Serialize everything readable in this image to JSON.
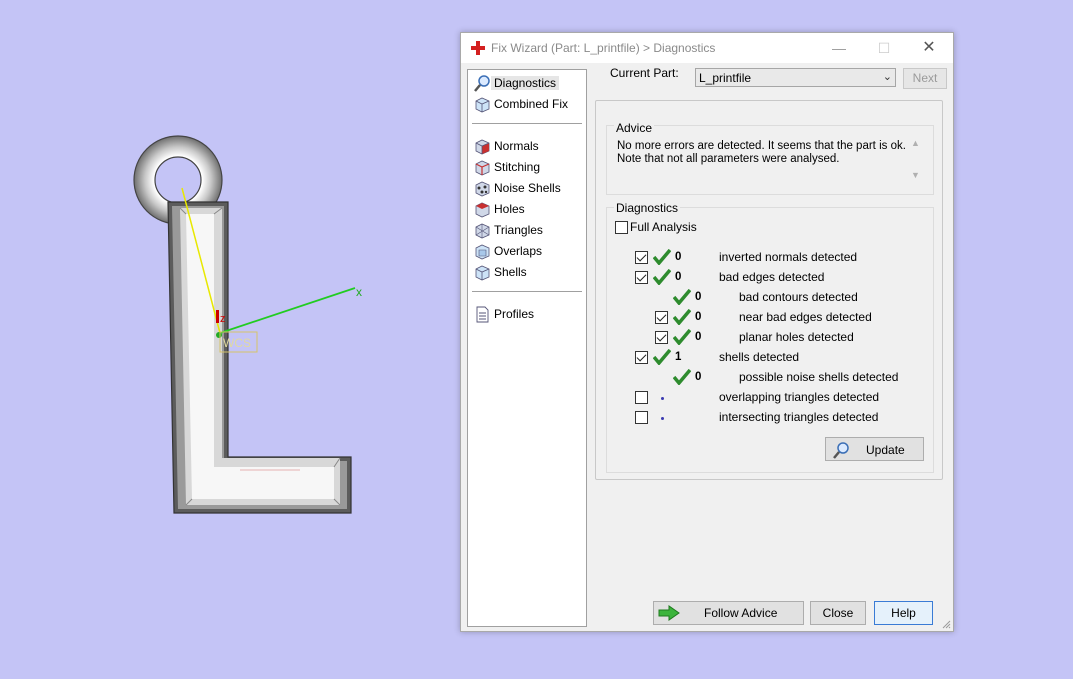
{
  "viewport": {
    "axis_x_label": "x",
    "axis_z_label": "z",
    "wcs_label": "WCS"
  },
  "window": {
    "title": "Fix Wizard (Part: L_printfile) > Diagnostics"
  },
  "nav": {
    "items_top": [
      {
        "label": "Diagnostics",
        "icon": "magnifier-icon",
        "selected": true
      },
      {
        "label": "Combined Fix",
        "icon": "cube-icon"
      }
    ],
    "items_mid": [
      {
        "label": "Normals",
        "icon": "normals-cube-icon"
      },
      {
        "label": "Stitching",
        "icon": "stitching-cube-icon"
      },
      {
        "label": "Noise Shells",
        "icon": "noise-shells-icon"
      },
      {
        "label": "Holes",
        "icon": "holes-cube-icon"
      },
      {
        "label": "Triangles",
        "icon": "triangles-cube-icon"
      },
      {
        "label": "Overlaps",
        "icon": "overlaps-cube-icon"
      },
      {
        "label": "Shells",
        "icon": "shells-cube-icon"
      }
    ],
    "items_bottom": [
      {
        "label": "Profiles",
        "icon": "document-icon"
      }
    ]
  },
  "toolbar": {
    "current_part_label": "Current Part:",
    "current_part_value": "L_printfile",
    "next_label": "Next"
  },
  "advice": {
    "title": "Advice",
    "line1": "No more errors are detected. It seems that the part is ok.",
    "line2": "Note that not all parameters were analysed."
  },
  "diagnostics": {
    "title": "Diagnostics",
    "full_analysis_label": "Full Analysis",
    "full_analysis_checked": false,
    "rows": [
      {
        "label": "inverted normals detected",
        "count": "0",
        "checked": true,
        "indent": false,
        "has_checkbox": true,
        "status": "ok"
      },
      {
        "label": "bad edges detected",
        "count": "0",
        "checked": true,
        "indent": false,
        "has_checkbox": true,
        "status": "ok"
      },
      {
        "label": "bad contours detected",
        "count": "0",
        "checked": false,
        "indent": true,
        "has_checkbox": false,
        "status": "ok"
      },
      {
        "label": "near bad edges detected",
        "count": "0",
        "checked": true,
        "indent": true,
        "has_checkbox": true,
        "status": "ok"
      },
      {
        "label": "planar holes detected",
        "count": "0",
        "checked": true,
        "indent": true,
        "has_checkbox": true,
        "status": "ok"
      },
      {
        "label": "shells detected",
        "count": "1",
        "checked": true,
        "indent": false,
        "has_checkbox": true,
        "status": "ok"
      },
      {
        "label": "possible noise shells detected",
        "count": "0",
        "checked": false,
        "indent": true,
        "has_checkbox": false,
        "status": "ok"
      },
      {
        "label": "overlapping triangles detected",
        "count": "",
        "checked": false,
        "indent": false,
        "has_checkbox": true,
        "status": "pending"
      },
      {
        "label": "intersecting triangles detected",
        "count": "",
        "checked": false,
        "indent": false,
        "has_checkbox": true,
        "status": "pending"
      }
    ],
    "update_label": "Update"
  },
  "footer": {
    "follow_advice_label": "Follow Advice",
    "close_label": "Close",
    "help_label": "Help"
  },
  "colors": {
    "background": "#c4c4f6",
    "check_green": "#2e8b2e",
    "axis_green": "#22cc22",
    "axis_yellow": "#e8e800",
    "axis_red": "#cc0000"
  }
}
